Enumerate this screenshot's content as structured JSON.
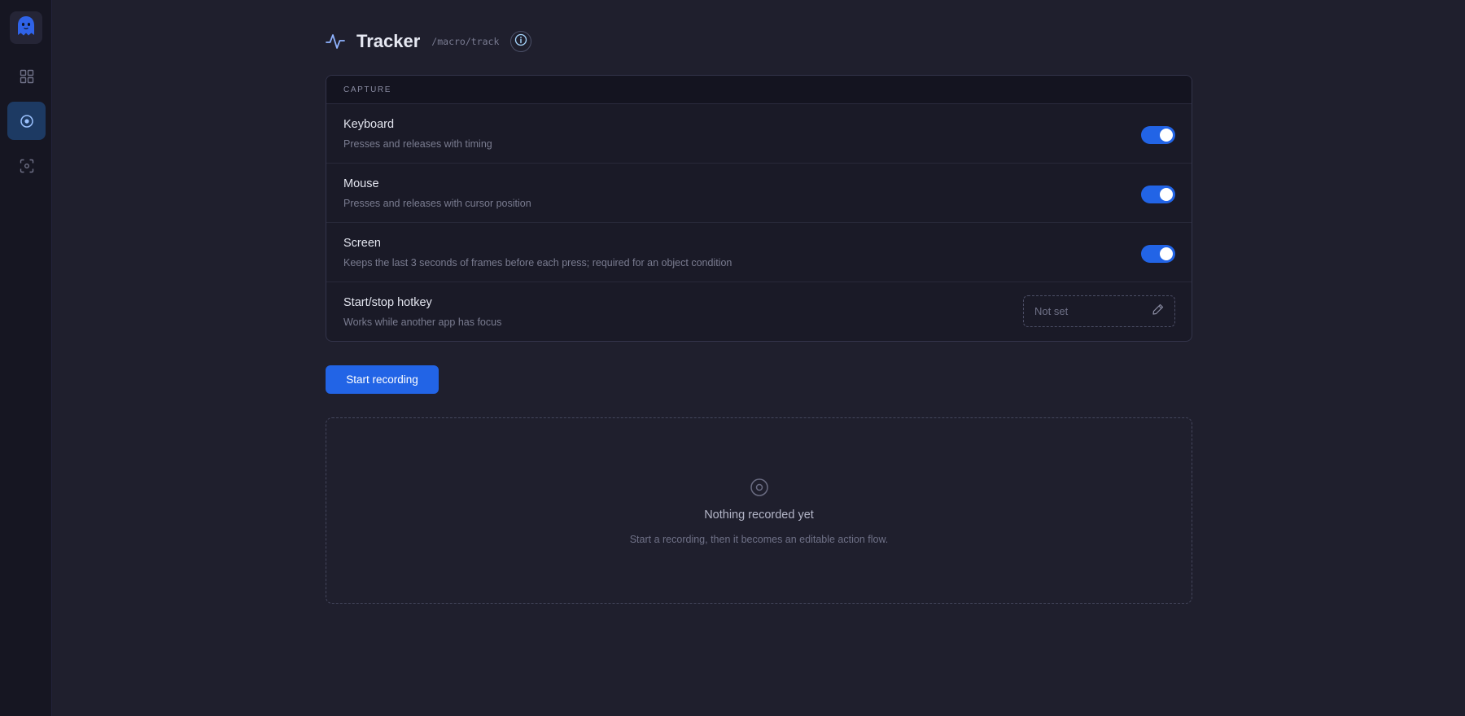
{
  "sidebar": {
    "logo_icon": "ghost-icon",
    "items": [
      {
        "name": "dashboard",
        "icon": "grid-icon",
        "active": false
      },
      {
        "name": "tracker",
        "icon": "record-icon",
        "active": true
      },
      {
        "name": "capture",
        "icon": "scan-icon",
        "active": false
      }
    ]
  },
  "header": {
    "icon": "pulse-icon",
    "title": "Tracker",
    "route": "/macro/track",
    "info_icon": "info-icon"
  },
  "capture": {
    "heading": "CAPTURE",
    "rows": [
      {
        "title": "Keyboard",
        "description": "Presses and releases with timing",
        "enabled": true
      },
      {
        "title": "Mouse",
        "description": "Presses and releases with cursor position",
        "enabled": true
      },
      {
        "title": "Screen",
        "description": "Keeps the last 3 seconds of frames before each press; required for an object condition",
        "enabled": true
      }
    ],
    "hotkey": {
      "title": "Start/stop hotkey",
      "description": "Works while another app has focus",
      "value": "Not set",
      "edit_icon": "pencil-icon"
    }
  },
  "actions": {
    "start_label": "Start recording"
  },
  "empty_state": {
    "icon": "record-icon",
    "title": "Nothing recorded yet",
    "subtitle": "Start a recording, then it becomes an editable action flow."
  },
  "colors": {
    "accent": "#2264e6",
    "background": "#1f1f2d",
    "sidebar": "#161622",
    "card": "#1a1a27"
  }
}
